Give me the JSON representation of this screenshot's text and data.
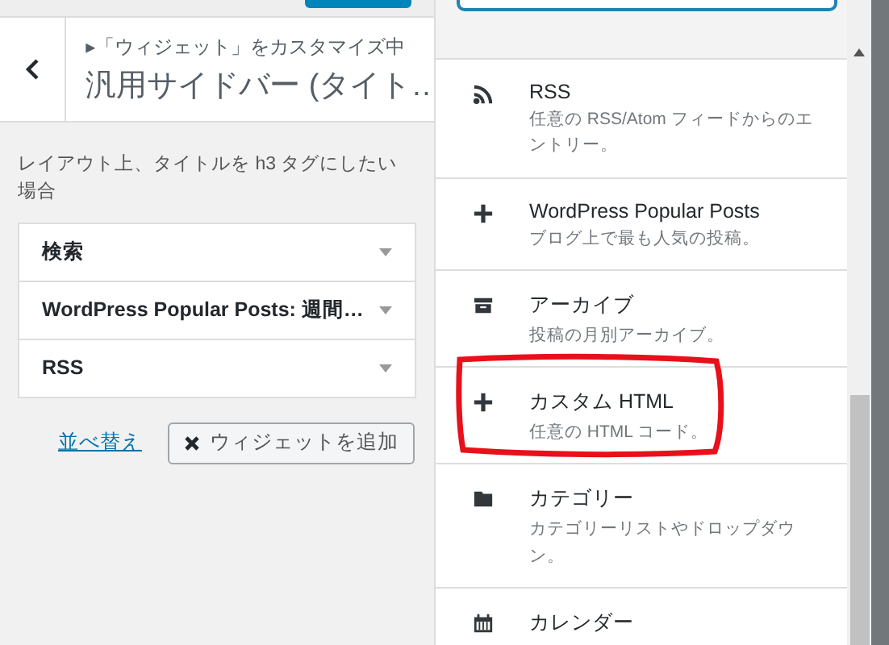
{
  "customizer": {
    "breadcrumb": "▸「ウィジェット」をカスタマイズ中",
    "title": "汎用サイドバー (タイト…",
    "description": "レイアウト上、タイトルを h3 タグにしたい場合",
    "widgets": [
      {
        "label": "検索"
      },
      {
        "label": "WordPress Popular Posts: 週間…"
      },
      {
        "label": "RSS"
      }
    ],
    "reorder_link": "並べ替え",
    "add_button": "ウィジェットを追加"
  },
  "available_widgets": [
    {
      "kind": "rss",
      "title": "RSS",
      "description": "任意の RSS/Atom フィードからのエントリー。",
      "highlighted": false
    },
    {
      "kind": "plus",
      "title": "WordPress Popular Posts",
      "description": "ブログ上で最も人気の投稿。",
      "highlighted": false
    },
    {
      "kind": "archive",
      "title": "アーカイブ",
      "description": "投稿の月別アーカイブ。",
      "highlighted": false
    },
    {
      "kind": "plus",
      "title": "カスタム HTML",
      "description": "任意の HTML コード。",
      "highlighted": true
    },
    {
      "kind": "folder",
      "title": "カテゴリー",
      "description": "カテゴリーリストやドロップダウン。",
      "highlighted": false
    },
    {
      "kind": "calendar",
      "title": "カレンダー",
      "highlighted": false
    }
  ]
}
